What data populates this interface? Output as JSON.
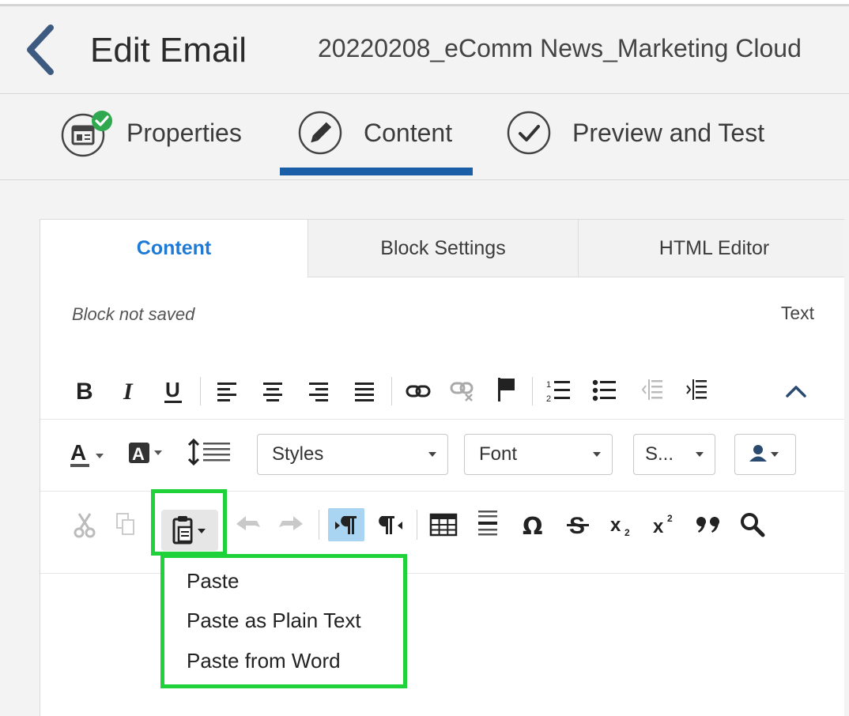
{
  "header": {
    "title": "Edit Email",
    "email_name": "20220208_eComm News_Marketing Cloud"
  },
  "steps": [
    {
      "label": "Properties",
      "icon": "properties-check-icon"
    },
    {
      "label": "Content",
      "icon": "pencil-icon"
    },
    {
      "label": "Preview and Test",
      "icon": "checkmark-circle-icon"
    }
  ],
  "editor_tabs": [
    "Content",
    "Block Settings",
    "HTML Editor"
  ],
  "status": {
    "block_state": "Block not saved",
    "block_type": "Text"
  },
  "toolbar": {
    "styles": "Styles",
    "font": "Font",
    "size": "S...",
    "paste_menu": [
      "Paste",
      "Paste as Plain Text",
      "Paste from Word"
    ]
  },
  "colors": {
    "accent": "#1a5ea8",
    "active_tab": "#1f7ad6",
    "highlight": "#1fd23a",
    "success": "#2fa84f"
  }
}
